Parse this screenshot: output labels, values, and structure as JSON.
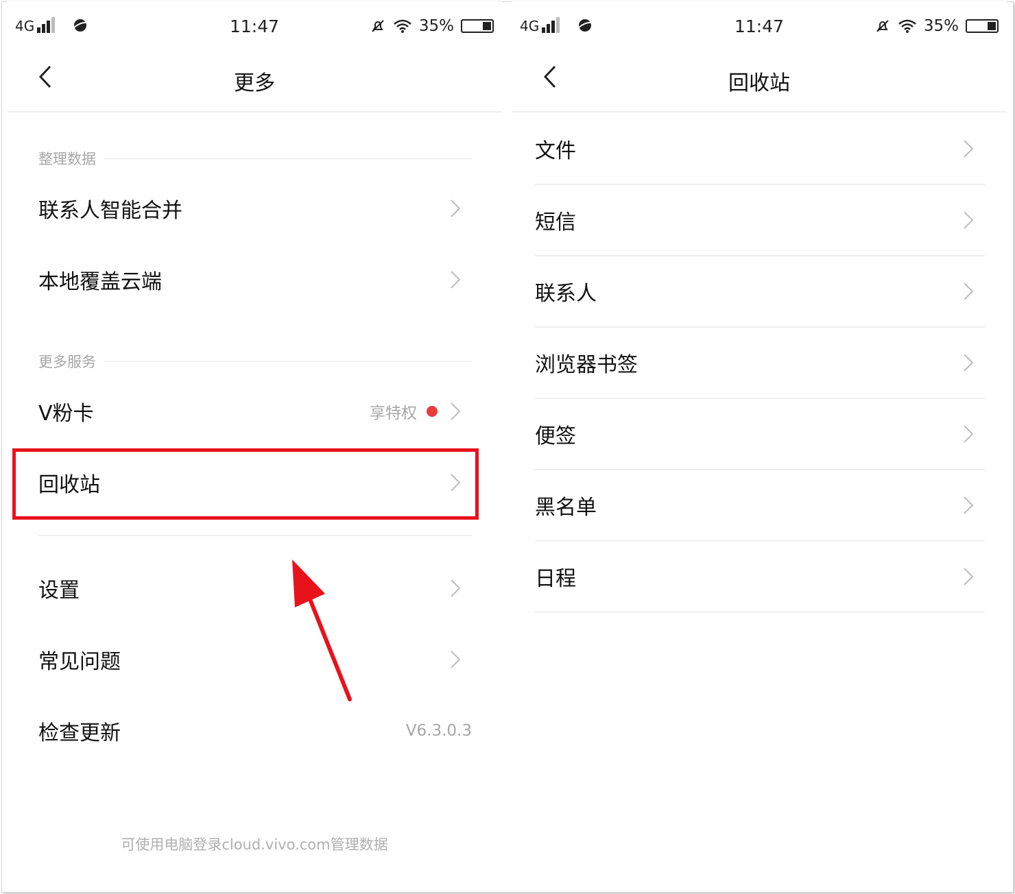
{
  "status_bar": {
    "network": "4G",
    "time": "11:47",
    "battery": "35%"
  },
  "left_screen": {
    "header_title": "更多",
    "section_data": "整理数据",
    "items_data": [
      {
        "label": "联系人智能合并"
      },
      {
        "label": "本地覆盖云端"
      }
    ],
    "section_services": "更多服务",
    "vfan": {
      "label": "V粉卡",
      "extra": "享特权"
    },
    "recycle": {
      "label": "回收站"
    },
    "settings": {
      "label": "设置"
    },
    "faq": {
      "label": "常见问题"
    },
    "update": {
      "label": "检查更新",
      "version": "V6.3.0.3"
    },
    "footer": "可使用电脑登录cloud.vivo.com管理数据"
  },
  "right_screen": {
    "header_title": "回收站",
    "items": [
      {
        "label": "文件"
      },
      {
        "label": "短信"
      },
      {
        "label": "联系人"
      },
      {
        "label": "浏览器书签"
      },
      {
        "label": "便签"
      },
      {
        "label": "黑名单"
      },
      {
        "label": "日程"
      }
    ]
  },
  "colors": {
    "highlight": "#e8121b",
    "badge_dot": "#ea3c3c",
    "secondary_text": "#a6a6a6"
  }
}
